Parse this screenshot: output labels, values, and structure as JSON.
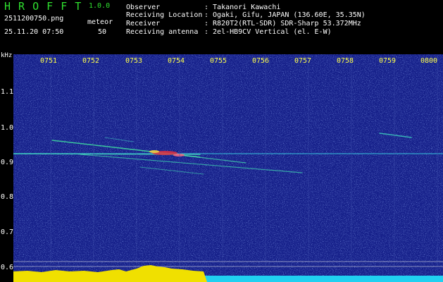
{
  "app": {
    "name": "H R O F F T",
    "version": "1.0.0"
  },
  "file": {
    "name": "2511200750.png",
    "datetime": "25.11.20 07:50"
  },
  "meteor": {
    "label": "meteor",
    "count": "50"
  },
  "header": {
    "rows": [
      {
        "key": "Observer",
        "value": ": Takanori Kawachi"
      },
      {
        "key": "Receiving Location",
        "value": ": Ogaki, Gifu, JAPAN (136.60E, 35.35N)"
      },
      {
        "key": "Receiver",
        "value": ": R820T2(RTL-SDR) SDR-Sharp 53.372MHz"
      },
      {
        "key": "Receiving antenna",
        "value": ": 2el-HB9CV Vertical (el. E-W)"
      }
    ]
  },
  "yaxis": {
    "unit": "kHz",
    "ticks": [
      "1.1",
      "1.0",
      "0.9",
      "0.8",
      "0.7",
      "0.6"
    ]
  },
  "xaxis": {
    "minutes": [
      "0751",
      "0752",
      "0753",
      "0754",
      "0755",
      "0756",
      "0757",
      "0758",
      "0759",
      "0800"
    ]
  },
  "colors": {
    "background": "#16208a",
    "title": "#2fe02f",
    "minute_label": "#ffff4a",
    "bottom_bar": "#20d0f0",
    "level_bar": "#f0e000"
  }
}
